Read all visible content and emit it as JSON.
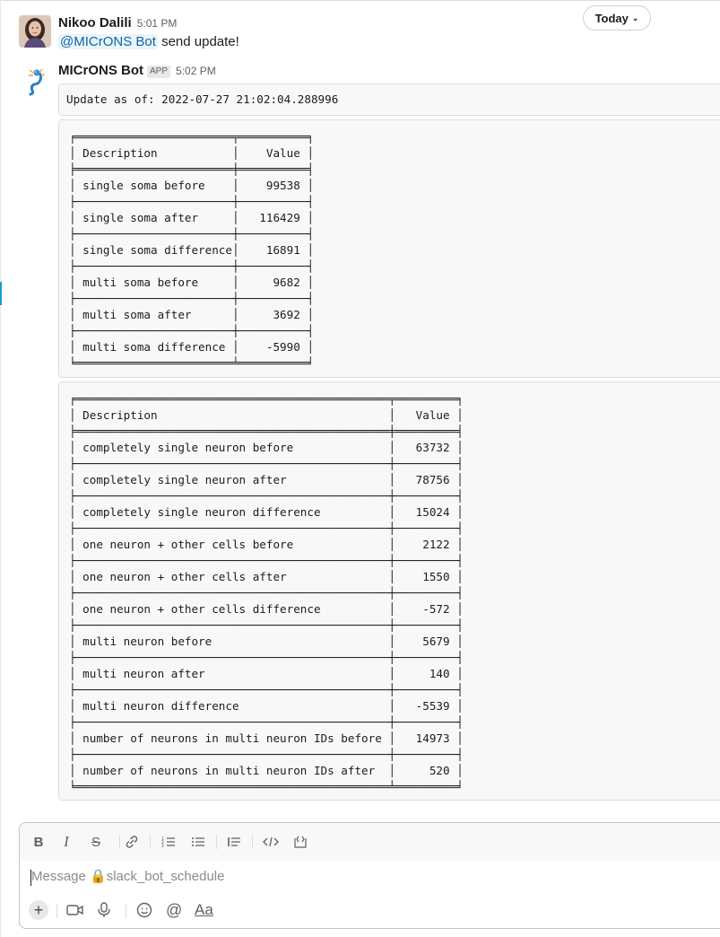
{
  "header": {
    "date_divider": "Today"
  },
  "messages": [
    {
      "sender": "Nikoo Dalili",
      "time": "5:01 PM",
      "mention": "@MICrONS Bot",
      "text": " send update!"
    },
    {
      "sender": "MICrONS Bot",
      "badge": "APP",
      "time": "5:02 PM",
      "update_line": "Update as of: 2022-07-27 21:02:04.288996",
      "table1": "╒═══════════════════════╤══════════╕\n│ Description           │    Value │\n╞═══════════════════════╪══════════╡\n│ single soma before    │    99538 │\n├───────────────────────┼──────────┤\n│ single soma after     │   116429 │\n├───────────────────────┼──────────┤\n│ single soma difference│    16891 │\n├───────────────────────┼──────────┤\n│ multi soma before     │     9682 │\n├───────────────────────┼──────────┤\n│ multi soma after      │     3692 │\n├───────────────────────┼──────────┤\n│ multi soma difference │    -5990 │\n╘═══════════════════════╧══════════╛",
      "table2": "╒══════════════════════════════════════════════╤═════════╕\n│ Description                                  │   Value │\n╞══════════════════════════════════════════════╪═════════╡\n│ completely single neuron before              │   63732 │\n├──────────────────────────────────────────────┼─────────┤\n│ completely single neuron after               │   78756 │\n├──────────────────────────────────────────────┼─────────┤\n│ completely single neuron difference          │   15024 │\n├──────────────────────────────────────────────┼─────────┤\n│ one neuron + other cells before              │    2122 │\n├──────────────────────────────────────────────┼─────────┤\n│ one neuron + other cells after               │    1550 │\n├──────────────────────────────────────────────┼─────────┤\n│ one neuron + other cells difference          │    -572 │\n├──────────────────────────────────────────────┼─────────┤\n│ multi neuron before                          │    5679 │\n├──────────────────────────────────────────────┼─────────┤\n│ multi neuron after                           │     140 │\n├──────────────────────────────────────────────┼─────────┤\n│ multi neuron difference                      │   -5539 │\n├──────────────────────────────────────────────┼─────────┤\n│ number of neurons in multi neuron IDs before │   14973 │\n├──────────────────────────────────────────────┼─────────┤\n│ number of neurons in multi neuron IDs after  │     520 │\n╘══════════════════════════════════════════════╧═════════╛"
    }
  ],
  "composer": {
    "placeholder": "Message 🔒slack_bot_schedule",
    "toolbar": [
      "bold-icon",
      "italic-icon",
      "strikethrough-icon",
      "link-icon",
      "ordered-list-icon",
      "bulleted-list-icon",
      "blockquote-icon",
      "code-icon",
      "code-block-icon"
    ],
    "bottom": [
      "plus-icon",
      "video-icon",
      "microphone-icon",
      "emoji-icon",
      "mention-icon",
      "text-format-icon"
    ],
    "format_label": "Aa"
  },
  "colors": {
    "mention_bg": "#e8f5fa",
    "mention_fg": "#1264a3",
    "accent": "#1d9bd1"
  }
}
